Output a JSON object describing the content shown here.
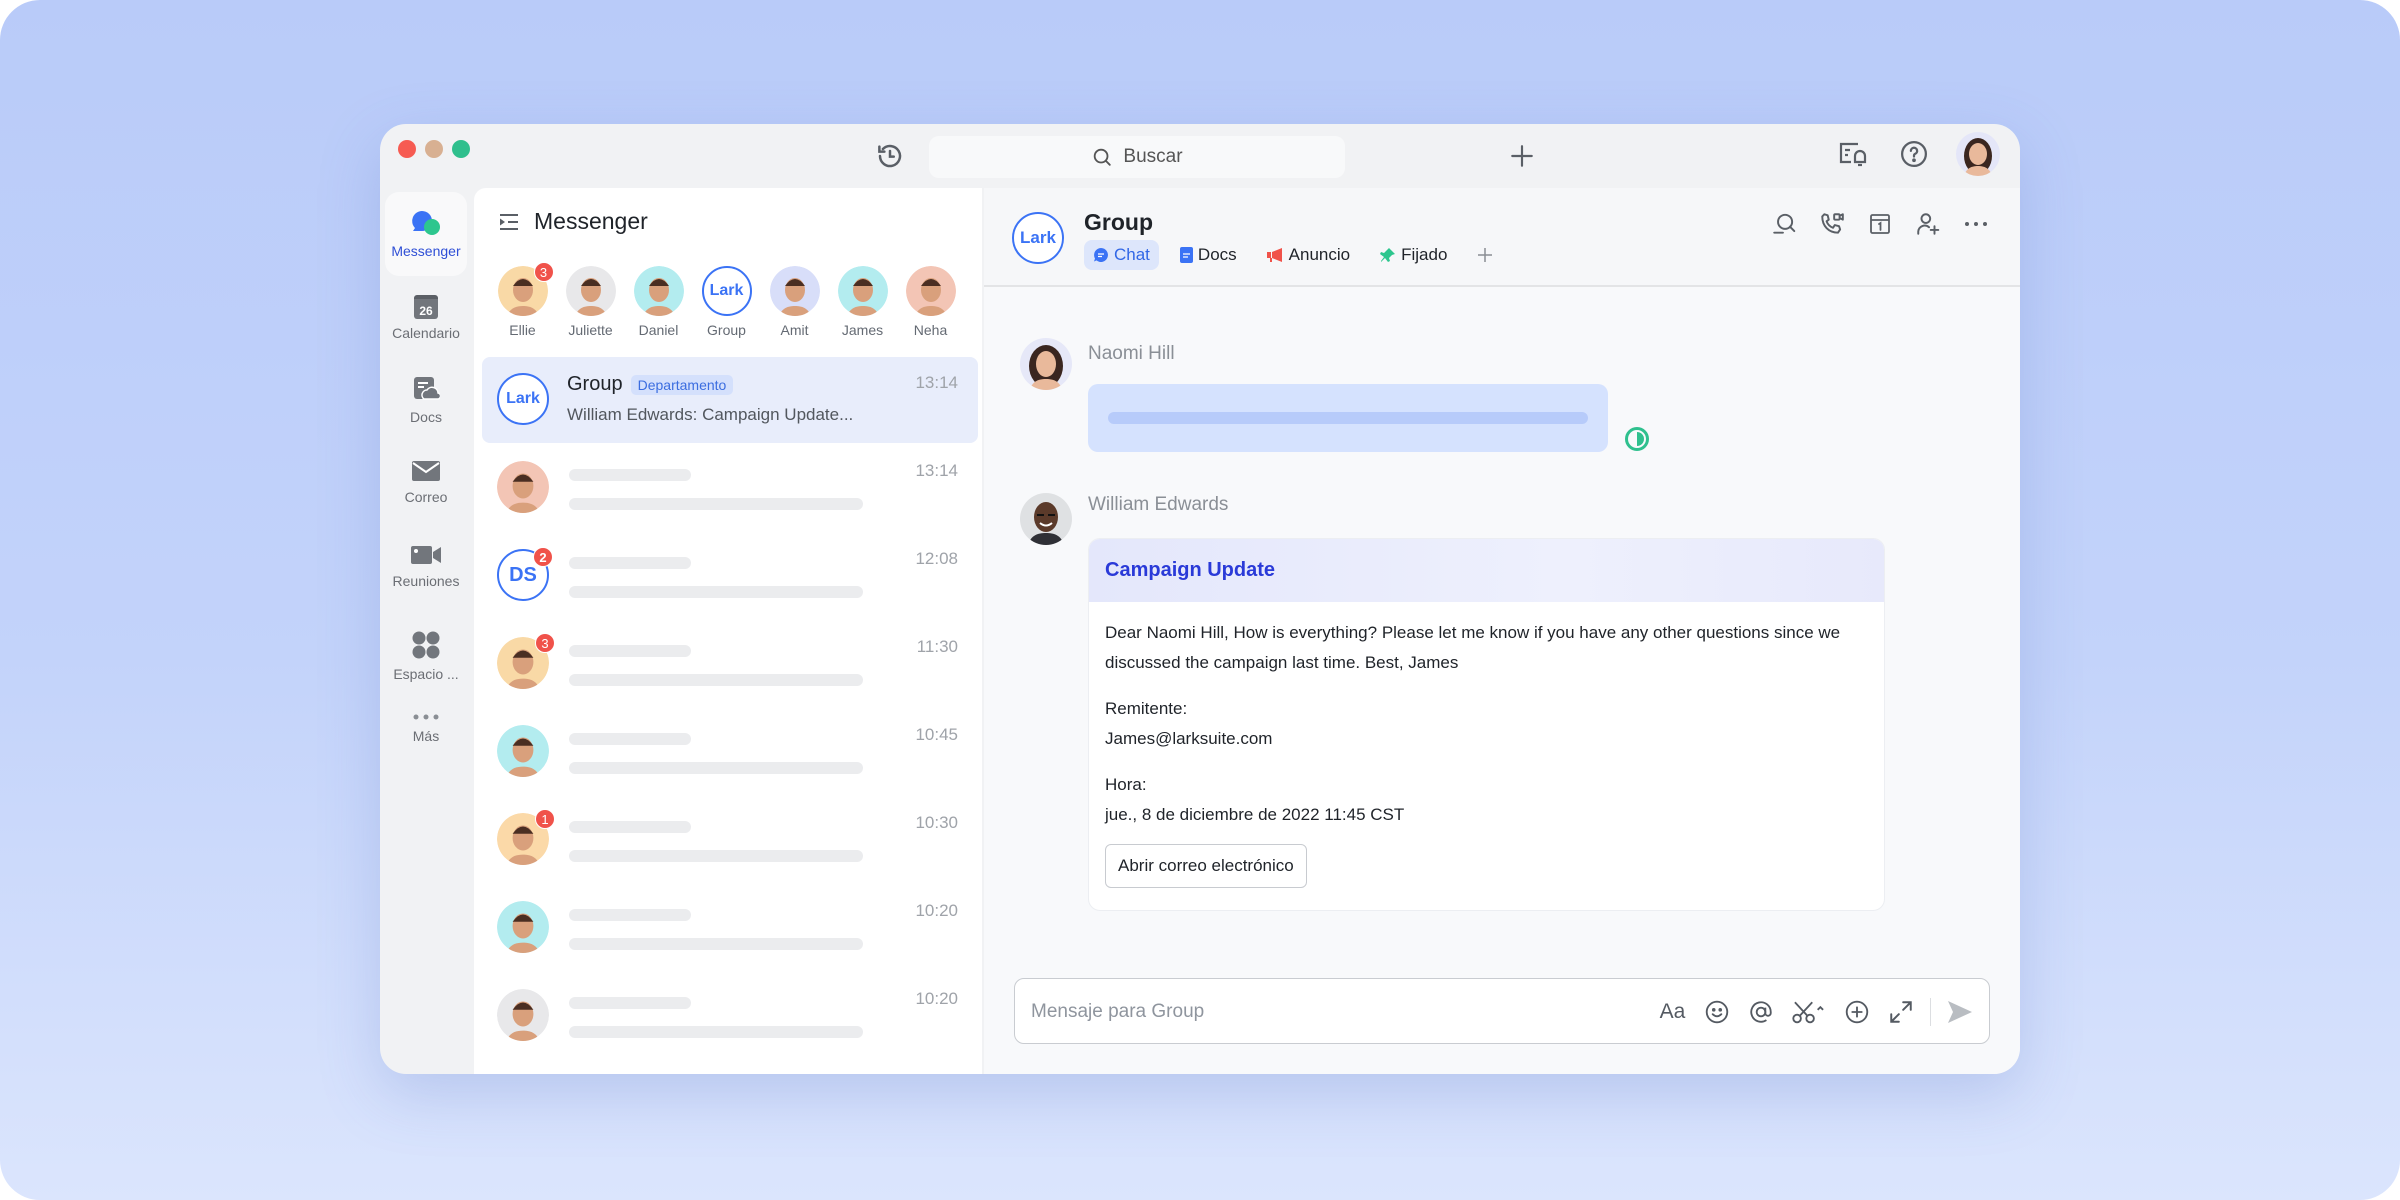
{
  "titlebar": {
    "search_placeholder": "Buscar",
    "icons": [
      "history-icon",
      "search-icon",
      "plus-icon",
      "notifications-icon",
      "help-icon",
      "user-avatar"
    ]
  },
  "nav": {
    "items": [
      {
        "label": "Messenger",
        "icon": "messenger-icon",
        "active": true
      },
      {
        "label": "Calendario",
        "icon": "calendar-icon",
        "calendar_day": "26"
      },
      {
        "label": "Docs",
        "icon": "docs-icon"
      },
      {
        "label": "Correo",
        "icon": "mail-icon"
      },
      {
        "label": "Reuniones",
        "icon": "video-icon"
      },
      {
        "label": "Espacio ...",
        "icon": "workspace-icon"
      },
      {
        "label": "Más",
        "icon": "more-icon"
      }
    ]
  },
  "list": {
    "title": "Messenger",
    "stories": [
      {
        "name": "Ellie",
        "badge": "3",
        "color": "#f9d9a6"
      },
      {
        "name": "Juliette",
        "badge": null,
        "color": "#e8e8ea"
      },
      {
        "name": "Daniel",
        "badge": null,
        "color": "#b3ecef"
      },
      {
        "name": "Group",
        "badge": null,
        "lark": "Lark"
      },
      {
        "name": "Amit",
        "badge": null,
        "color": "#d8def9"
      },
      {
        "name": "James",
        "badge": null,
        "color": "#b3ecef"
      },
      {
        "name": "Neha",
        "badge": null,
        "color": "#f3c5b5"
      }
    ],
    "conversations": [
      {
        "title": "Group",
        "tag": "Departamento",
        "preview": "William Edwards: Campaign Update...",
        "time": "13:14",
        "avatar_text": "Lark",
        "active": true
      },
      {
        "time": "13:14",
        "badge": null,
        "color": "#f3c5b5"
      },
      {
        "time": "12:08",
        "badge": "2",
        "avatar_text": "DS"
      },
      {
        "time": "11:30",
        "badge": "3",
        "color": "#f9d9a6"
      },
      {
        "time": "10:45",
        "badge": null,
        "color": "#b3ecef"
      },
      {
        "time": "10:30",
        "badge": "1",
        "color": "#fbd9a8"
      },
      {
        "time": "10:20",
        "badge": null,
        "color": "#b3ecef"
      },
      {
        "time": "10:20",
        "badge": null,
        "color": "#e8e8ea"
      }
    ]
  },
  "chat": {
    "avatar_text": "Lark",
    "title": "Group",
    "tabs": [
      {
        "label": "Chat",
        "icon": "chat-bubble-icon",
        "active": true
      },
      {
        "label": "Docs",
        "icon": "doc-icon"
      },
      {
        "label": "Anuncio",
        "icon": "megaphone-icon"
      },
      {
        "label": "Fijado",
        "icon": "pin-icon"
      }
    ],
    "tools": [
      "search-history-icon",
      "call-icon",
      "calendar-icon",
      "add-member-icon",
      "more-icon"
    ],
    "messages": [
      {
        "sender": "Naomi Hill",
        "type": "placeholder",
        "read_status": "partially-read"
      },
      {
        "sender": "William Edwards",
        "type": "card",
        "card": {
          "title": "Campaign Update",
          "body": "Dear Naomi Hill, How is everything? Please let me know if you have any other questions since we discussed the campaign last time. Best, James",
          "sender_label": "Remitente:",
          "sender_value": "James@larksuite.com",
          "time_label": "Hora:",
          "time_value": "jue., 8 de diciembre de 2022 11:45 CST",
          "button": "Abrir correo electrónico"
        }
      }
    ],
    "composer": {
      "placeholder": "Mensaje para Group",
      "value": "",
      "text_format_label": "Aa"
    }
  },
  "colors": {
    "accent": "#3b73f5",
    "badge": "#f0524a",
    "read": "#2fc08e",
    "card_title": "#2a3ad8"
  }
}
